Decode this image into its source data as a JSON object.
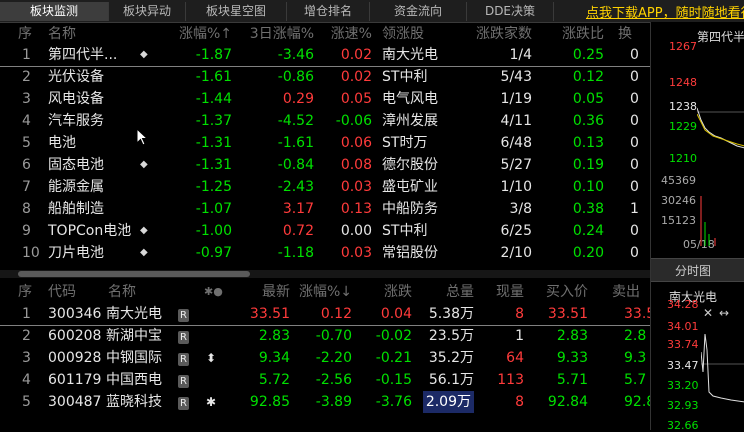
{
  "tabs": [
    "板块监测",
    "板块异动",
    "板块星空图",
    "增仓排名",
    "资金流向",
    "DDE决策"
  ],
  "promo": "点我下载APP，随时随地看行",
  "sector_headers": [
    "序",
    "名称",
    "涨幅%↑",
    "3日涨幅%",
    "涨速%",
    "领涨股",
    "涨跌家数",
    "涨跌比",
    "换"
  ],
  "sectors": [
    {
      "idx": "1",
      "name": "第四代半...",
      "mark": "◆",
      "chg": "-1.87",
      "chg3": "-3.46",
      "speed": "0.02",
      "leader": "南大光电",
      "updown": "1/4",
      "ratio": "0.25",
      "hs": "0"
    },
    {
      "idx": "2",
      "name": "光伏设备",
      "mark": "",
      "chg": "-1.61",
      "chg3": "-0.86",
      "speed": "0.02",
      "leader": "ST中利",
      "updown": "5/43",
      "ratio": "0.12",
      "hs": "0"
    },
    {
      "idx": "3",
      "name": "风电设备",
      "mark": "",
      "chg": "-1.44",
      "chg3": "0.29",
      "speed": "0.05",
      "leader": "电气风电",
      "updown": "1/19",
      "ratio": "0.05",
      "hs": "0"
    },
    {
      "idx": "4",
      "name": "汽车服务",
      "mark": "",
      "chg": "-1.37",
      "chg3": "-4.52",
      "speed": "-0.06",
      "leader": "漳州发展",
      "updown": "4/11",
      "ratio": "0.36",
      "hs": "0"
    },
    {
      "idx": "5",
      "name": "电池",
      "mark": "",
      "chg": "-1.31",
      "chg3": "-1.61",
      "speed": "0.06",
      "leader": "ST时万",
      "updown": "6/48",
      "ratio": "0.13",
      "hs": "0"
    },
    {
      "idx": "6",
      "name": "固态电池",
      "mark": "◆",
      "chg": "-1.31",
      "chg3": "-0.84",
      "speed": "0.08",
      "leader": "德尔股份",
      "updown": "5/27",
      "ratio": "0.19",
      "hs": "0"
    },
    {
      "idx": "7",
      "name": "能源金属",
      "mark": "",
      "chg": "-1.25",
      "chg3": "-2.43",
      "speed": "0.03",
      "leader": "盛屯矿业",
      "updown": "1/10",
      "ratio": "0.10",
      "hs": "0"
    },
    {
      "idx": "8",
      "name": "船舶制造",
      "mark": "",
      "chg": "-1.07",
      "chg3": "3.17",
      "speed": "0.13",
      "leader": "中船防务",
      "updown": "3/8",
      "ratio": "0.38",
      "hs": "1"
    },
    {
      "idx": "9",
      "name": "TOPCon电池",
      "mark": "◆",
      "chg": "-1.00",
      "chg3": "0.72",
      "speed": "0.00",
      "leader": "ST中利",
      "updown": "6/25",
      "ratio": "0.24",
      "hs": "0"
    },
    {
      "idx": "10",
      "name": "刀片电池",
      "mark": "◆",
      "chg": "-0.97",
      "chg3": "-1.18",
      "speed": "0.03",
      "leader": "常铝股份",
      "updown": "2/10",
      "ratio": "0.20",
      "hs": "0"
    }
  ],
  "stock_headers": [
    "序",
    "代码",
    "名称",
    "✱●",
    "最新",
    "涨幅%↓",
    "涨跌",
    "总量",
    "现量",
    "买入价",
    "卖出"
  ],
  "stocks": [
    {
      "idx": "1",
      "code": "300346",
      "name": "南大光电",
      "badge": "R",
      "flag": "",
      "last": "33.51",
      "chg": "0.12",
      "diff": "0.04",
      "vol": "5.38万",
      "cur": "8",
      "bid": "33.51",
      "ask": "33.5"
    },
    {
      "idx": "2",
      "code": "600208",
      "name": "新湖中宝",
      "badge": "R",
      "flag": "",
      "last": "2.83",
      "chg": "-0.70",
      "diff": "-0.02",
      "vol": "23.5万",
      "cur": "1",
      "bid": "2.83",
      "ask": "2.8"
    },
    {
      "idx": "3",
      "code": "000928",
      "name": "中钢国际",
      "badge": "R",
      "flag": "⬍",
      "last": "9.34",
      "chg": "-2.20",
      "diff": "-0.21",
      "vol": "35.2万",
      "cur": "64",
      "bid": "9.33",
      "ask": "9.3"
    },
    {
      "idx": "4",
      "code": "601179",
      "name": "中国西电",
      "badge": "R",
      "flag": "",
      "last": "5.72",
      "chg": "-2.56",
      "diff": "-0.15",
      "vol": "56.1万",
      "cur": "113",
      "bid": "5.71",
      "ask": "5.7"
    },
    {
      "idx": "5",
      "code": "300487",
      "name": "蓝晓科技",
      "badge": "R",
      "flag": "✱",
      "last": "92.85",
      "chg": "-3.89",
      "diff": "-3.76",
      "vol": "2.09万",
      "cur": "8",
      "bid": "92.84",
      "ask": "92.8"
    }
  ],
  "right_panel": {
    "title": "第四代半",
    "prices": [
      "1267",
      "1248",
      "1238",
      "1229",
      "1210"
    ],
    "vols": [
      "45369",
      "30246",
      "15123"
    ],
    "date": "05/18",
    "tab": "分时图",
    "stock_title": "南大光电",
    "stock_prices": [
      "34.28",
      "34.01",
      "33.74",
      "33.47",
      "33.20",
      "32.93",
      "32.66"
    ]
  },
  "colors": {
    "up": "#ff3b3b",
    "down": "#00e000",
    "accent": "#ffd200",
    "bg": "#000000"
  }
}
